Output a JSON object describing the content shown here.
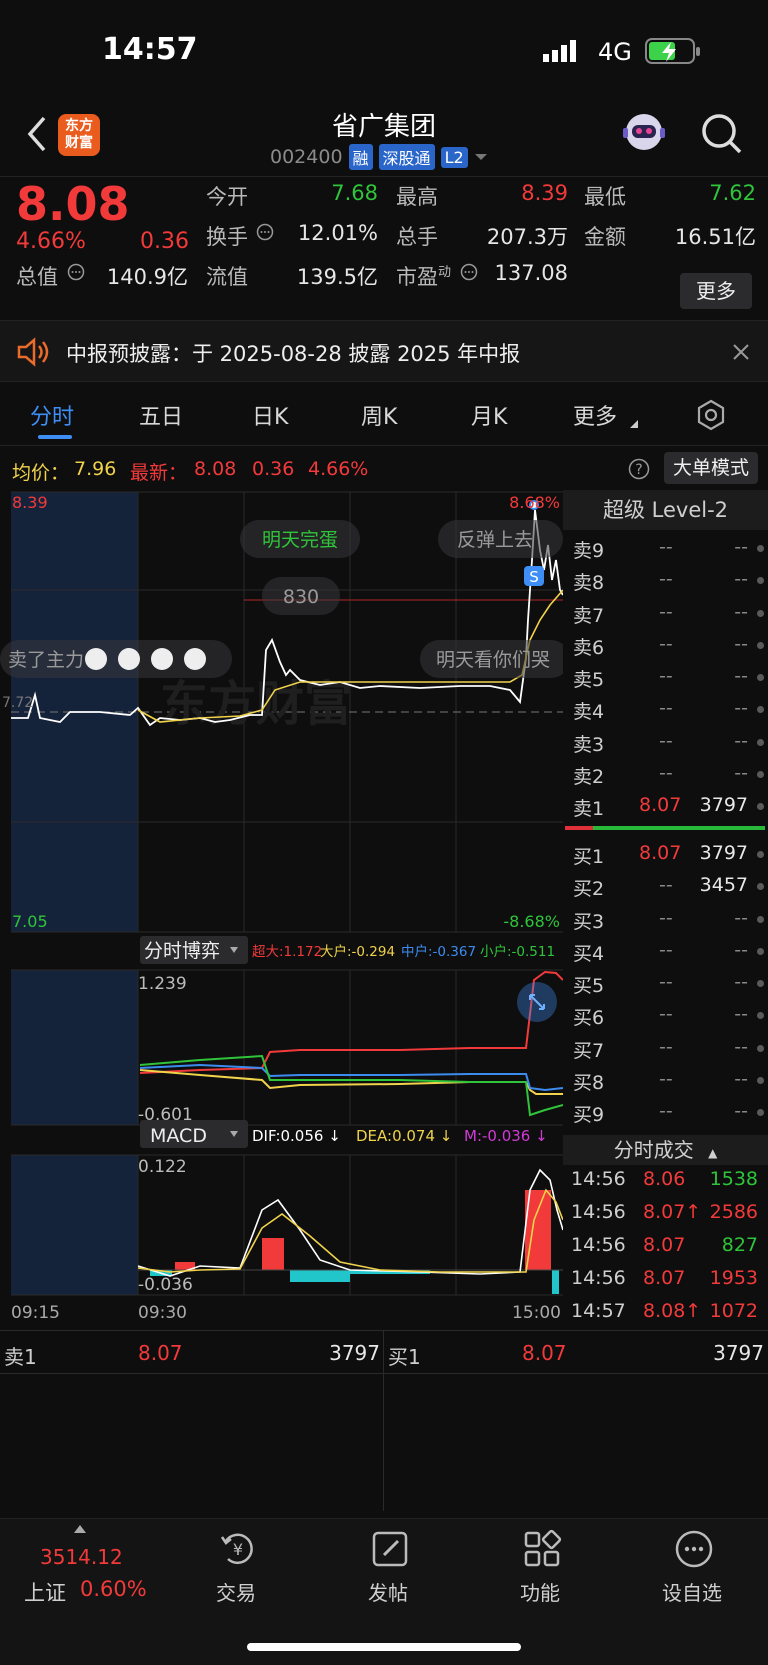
{
  "status": {
    "time": "14:57",
    "network": "4G"
  },
  "header": {
    "logo": "东方\n财富",
    "title": "省广集团",
    "code": "002400",
    "tags": [
      "融",
      "深股通",
      "L2"
    ]
  },
  "quote": {
    "price": "8.08",
    "pct": "4.66%",
    "change": "0.36",
    "open_label": "今开",
    "open": "7.68",
    "high_label": "最高",
    "high": "8.39",
    "low_label": "最低",
    "low": "7.62",
    "turnover_label": "换手",
    "turnover": "12.01%",
    "volume_label": "总手",
    "volume": "207.3万",
    "amount_label": "金额",
    "amount": "16.51亿",
    "mktcap_label": "总值",
    "mktcap": "140.9亿",
    "float_label": "流值",
    "float": "139.5亿",
    "pe_label": "市盈",
    "pe_sup": "动",
    "pe": "137.08",
    "more": "更多"
  },
  "notice": {
    "text": "中报预披露：于 2025-08-28 披露 2025 年中报"
  },
  "tabs": [
    "分时",
    "五日",
    "日K",
    "周K",
    "月K",
    "更多"
  ],
  "infobar": {
    "avg_label": "均价：",
    "avg": "7.96",
    "latest_label": "最新：",
    "latest": "8.08",
    "latest_chg": "0.36",
    "latest_pct": "4.66%",
    "mode_btn": "大单模式"
  },
  "chart": {
    "y_top": "8.39",
    "y_bottom": "7.05",
    "pct_top": "8.68%",
    "pct_bottom": "-8.68%",
    "mid_label": "7.72",
    "bubbles": [
      "明天完蛋",
      "反弹上去",
      "830",
      "卖了主力",
      "明天看你们哭"
    ],
    "s_marker": "S",
    "boyi_btn": "分时博弈",
    "boyi_legend": [
      {
        "label": "超大:1.172",
        "color": "#f23a3a"
      },
      {
        "label": "大户:-0.294",
        "color": "#f0d34a"
      },
      {
        "label": "中户:-0.367",
        "color": "#3c8cf0"
      },
      {
        "label": "小户:-0.511",
        "color": "#2fc43a"
      }
    ],
    "boyi_top": "1.239",
    "boyi_bottom": "-0.601",
    "macd_btn": "MACD",
    "macd_legend": [
      {
        "label": "DIF:0.056 ↓",
        "color": "#ffffff"
      },
      {
        "label": "DEA:0.074 ↓",
        "color": "#f0d34a"
      },
      {
        "label": "M:-0.036 ↓",
        "color": "#d23ad6"
      }
    ],
    "macd_top": "0.122",
    "macd_bottom": "-0.036",
    "times": [
      "09:15",
      "09:30",
      "15:00"
    ]
  },
  "orderbook": {
    "title": "超级 Level-2",
    "asks": [
      {
        "label": "卖9",
        "price": "--",
        "vol": "--"
      },
      {
        "label": "卖8",
        "price": "--",
        "vol": "--"
      },
      {
        "label": "卖7",
        "price": "--",
        "vol": "--"
      },
      {
        "label": "卖6",
        "price": "--",
        "vol": "--"
      },
      {
        "label": "卖5",
        "price": "--",
        "vol": "--"
      },
      {
        "label": "卖4",
        "price": "--",
        "vol": "--"
      },
      {
        "label": "卖3",
        "price": "--",
        "vol": "--"
      },
      {
        "label": "卖2",
        "price": "--",
        "vol": "--"
      },
      {
        "label": "卖1",
        "price": "8.07",
        "vol": "3797"
      }
    ],
    "bids": [
      {
        "label": "买1",
        "price": "8.07",
        "vol": "3797"
      },
      {
        "label": "买2",
        "price": "--",
        "vol": "3457"
      },
      {
        "label": "买3",
        "price": "--",
        "vol": "--"
      },
      {
        "label": "买4",
        "price": "--",
        "vol": "--"
      },
      {
        "label": "买5",
        "price": "--",
        "vol": "--"
      },
      {
        "label": "买6",
        "price": "--",
        "vol": "--"
      },
      {
        "label": "买7",
        "price": "--",
        "vol": "--"
      },
      {
        "label": "买8",
        "price": "--",
        "vol": "--"
      },
      {
        "label": "买9",
        "price": "--",
        "vol": "--"
      }
    ]
  },
  "trades": {
    "title": "分时成交",
    "rows": [
      {
        "time": "14:56",
        "price": "8.06",
        "vol": "1538",
        "dir": "down"
      },
      {
        "time": "14:56",
        "price": "8.07↑",
        "vol": "2586",
        "dir": "up"
      },
      {
        "time": "14:56",
        "price": "8.07",
        "vol": "827",
        "dir": "down"
      },
      {
        "time": "14:56",
        "price": "8.07",
        "vol": "1953",
        "dir": "up"
      },
      {
        "time": "14:57",
        "price": "8.08↑",
        "vol": "1072",
        "dir": "up"
      }
    ]
  },
  "bottom_quote": {
    "ask_label": "卖1",
    "ask_price": "8.07",
    "ask_vol": "3797",
    "bid_label": "买1",
    "bid_price": "8.07",
    "bid_vol": "3797"
  },
  "nav": {
    "index_value": "3514.12",
    "index_name": "上证",
    "index_pct": "0.60%",
    "items": [
      "交易",
      "发帖",
      "功能",
      "设自选"
    ]
  }
}
